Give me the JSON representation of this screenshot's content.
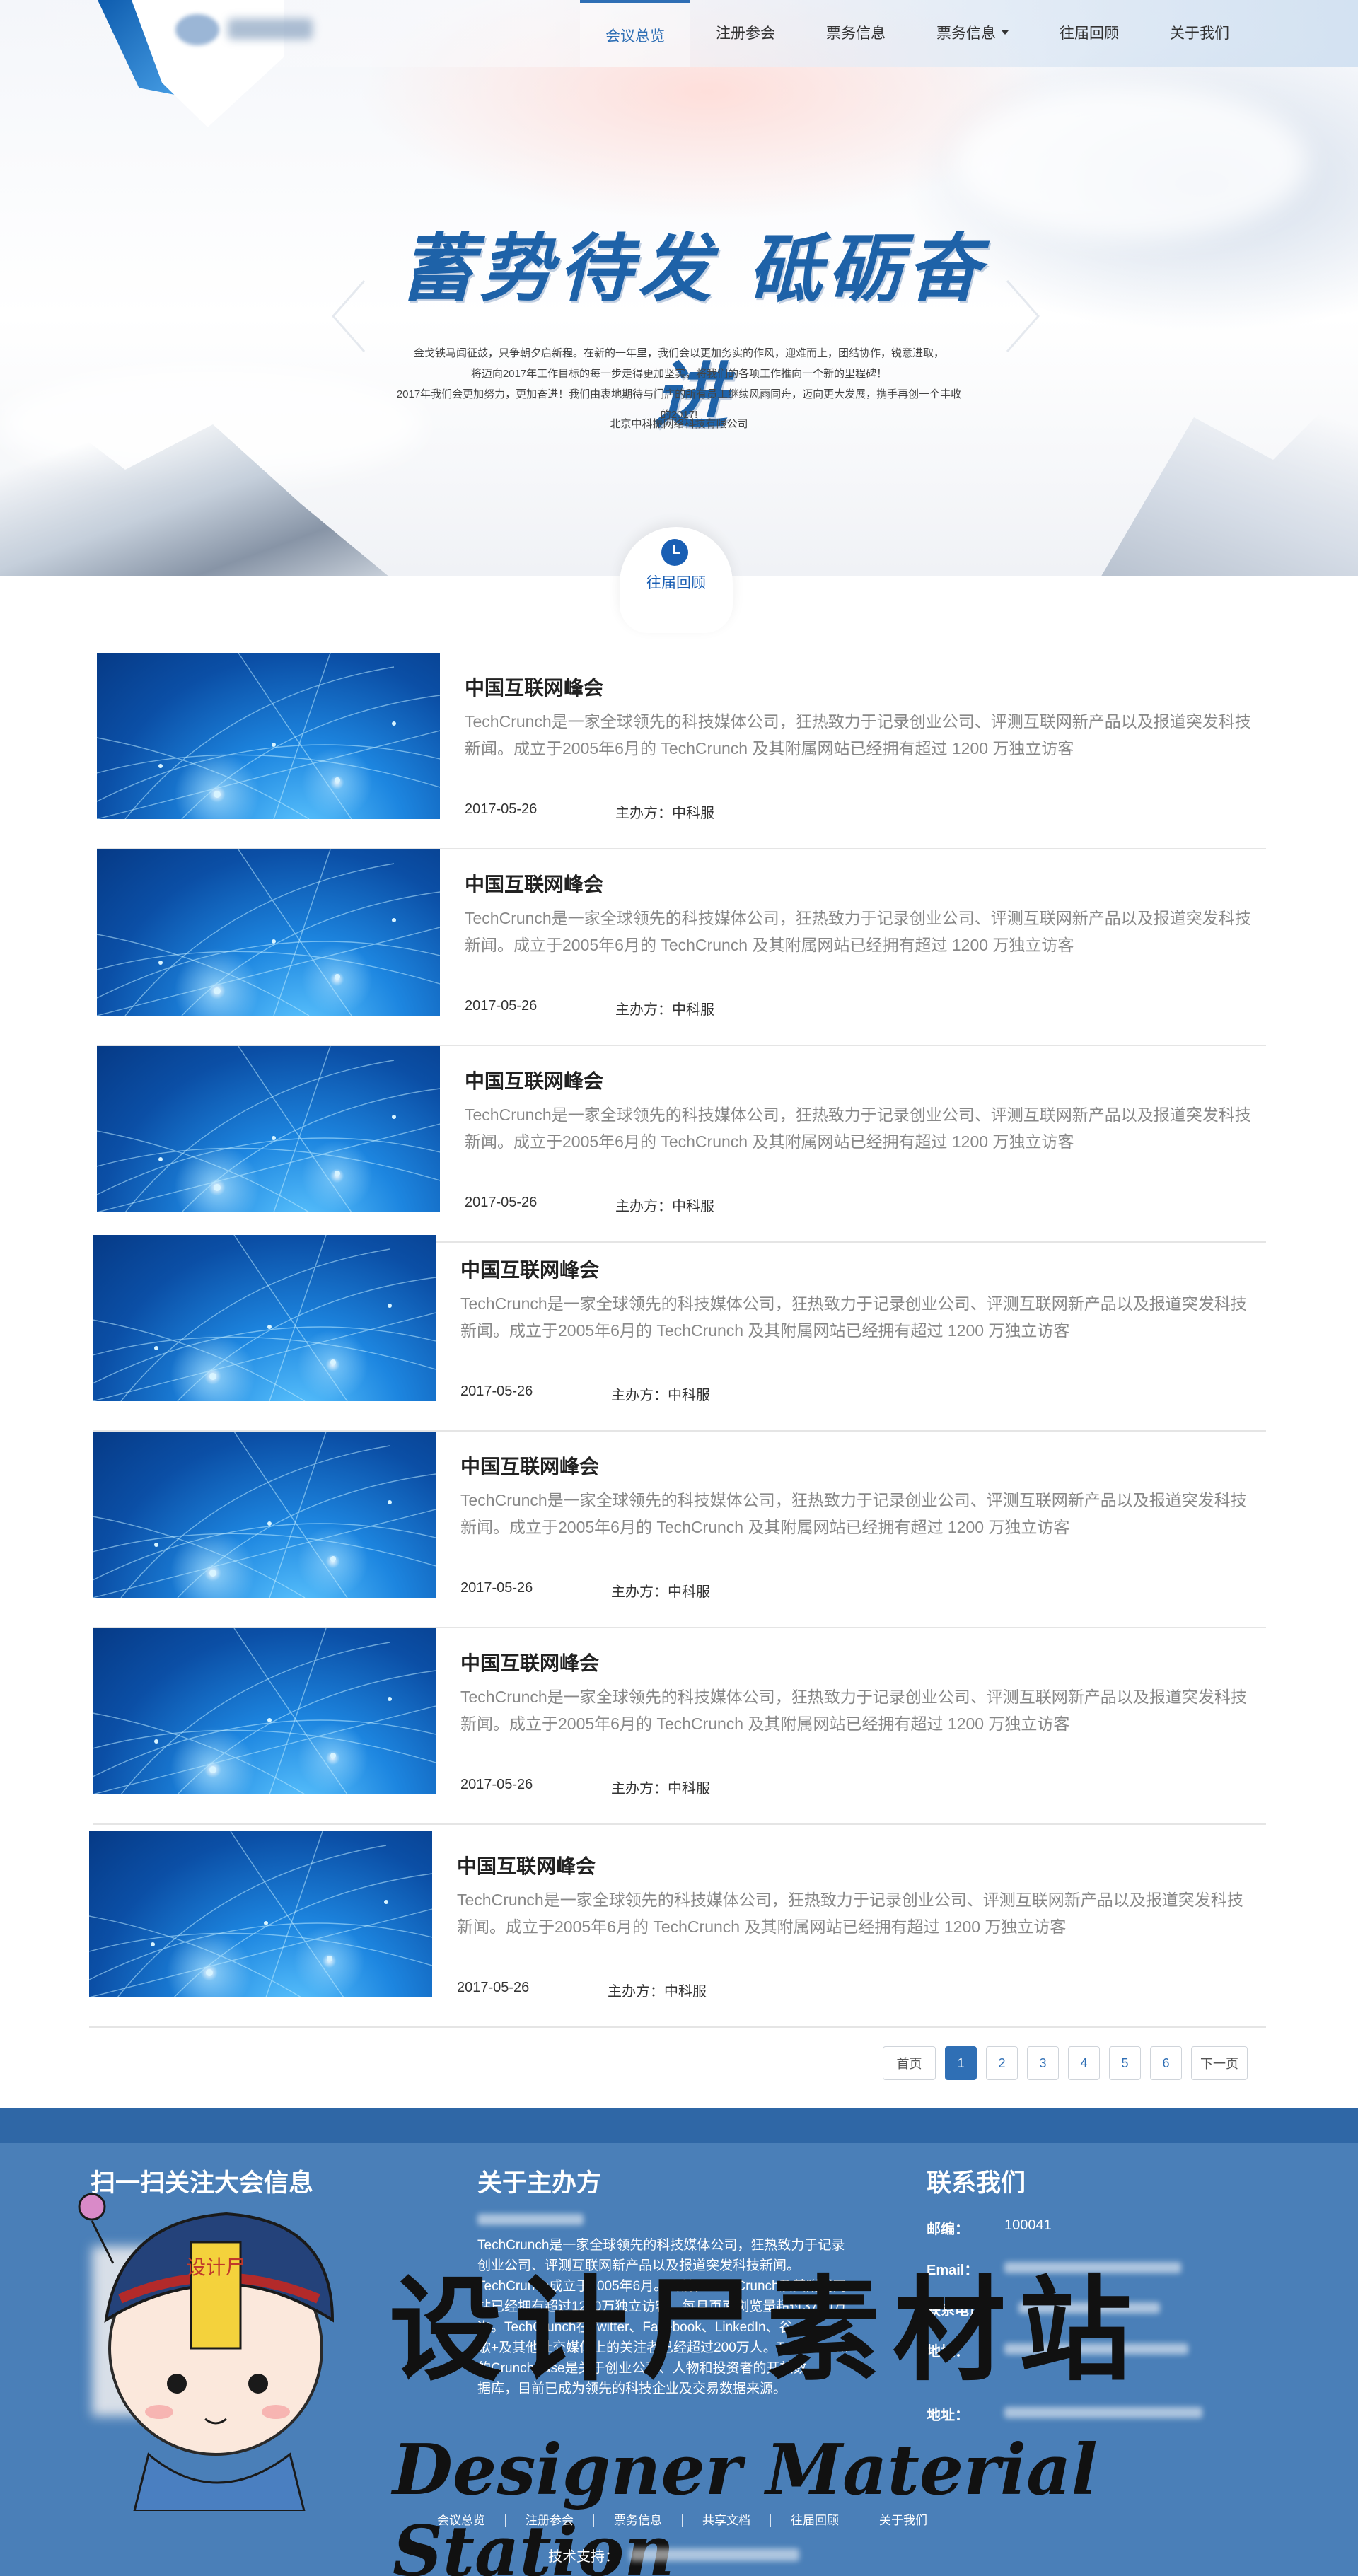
{
  "nav": {
    "items": [
      {
        "label": "会议总览",
        "active": true
      },
      {
        "label": "注册参会"
      },
      {
        "label": "票务信息"
      },
      {
        "label": "票务信息",
        "dropdown": true
      },
      {
        "label": "往届回顾"
      },
      {
        "label": "关于我们"
      }
    ]
  },
  "hero": {
    "slogan": "蓄势待发 砥砺奋进",
    "body_lines": [
      "金戈铁马闻征鼓，只争朝夕启新程。在新的一年里，我们会以更加务实的作风，迎难而上，团结协作，锐意进取，",
      "将迈向2017年工作目标的每一步走得更加坚实，将我们的各项工作推向一个新的里程碑！",
      "2017年我们会更加努力，更加奋进！我们由衷地期待与门店的所有员工继续风雨同舟，迈向更大发展，携手再创一个丰收的2017!"
    ],
    "signature": "北京中科振网络科技有限公司"
  },
  "badge": {
    "label": "往届回顾",
    "icon": "clock-icon"
  },
  "items": [
    {
      "title": "中国互联网峰会",
      "desc": "TechCrunch是一家全球领先的科技媒体公司，狂热致力于记录创业公司、评测互联网新产品以及报道突发科技新闻。成立于2005年6月的 TechCrunch 及其附属网站已经拥有超过 1200 万独立访客",
      "date": "2017-05-26",
      "org": "主办方：中科服"
    },
    {
      "title": "中国互联网峰会",
      "desc": "TechCrunch是一家全球领先的科技媒体公司，狂热致力于记录创业公司、评测互联网新产品以及报道突发科技新闻。成立于2005年6月的 TechCrunch 及其附属网站已经拥有超过 1200 万独立访客",
      "date": "2017-05-26",
      "org": "主办方：中科服"
    },
    {
      "title": "中国互联网峰会",
      "desc": "TechCrunch是一家全球领先的科技媒体公司，狂热致力于记录创业公司、评测互联网新产品以及报道突发科技新闻。成立于2005年6月的 TechCrunch 及其附属网站已经拥有超过 1200 万独立访客",
      "date": "2017-05-26",
      "org": "主办方：中科服"
    },
    {
      "title": "中国互联网峰会",
      "desc": "TechCrunch是一家全球领先的科技媒体公司，狂热致力于记录创业公司、评测互联网新产品以及报道突发科技新闻。成立于2005年6月的 TechCrunch 及其附属网站已经拥有超过 1200 万独立访客",
      "date": "2017-05-26",
      "org": "主办方：中科服"
    },
    {
      "title": "中国互联网峰会",
      "desc": "TechCrunch是一家全球领先的科技媒体公司，狂热致力于记录创业公司、评测互联网新产品以及报道突发科技新闻。成立于2005年6月的 TechCrunch 及其附属网站已经拥有超过 1200 万独立访客",
      "date": "2017-05-26",
      "org": "主办方：中科服"
    },
    {
      "title": "中国互联网峰会",
      "desc": "TechCrunch是一家全球领先的科技媒体公司，狂热致力于记录创业公司、评测互联网新产品以及报道突发科技新闻。成立于2005年6月的 TechCrunch 及其附属网站已经拥有超过 1200 万独立访客",
      "date": "2017-05-26",
      "org": "主办方：中科服"
    },
    {
      "title": "中国互联网峰会",
      "desc": "TechCrunch是一家全球领先的科技媒体公司，狂热致力于记录创业公司、评测互联网新产品以及报道突发科技新闻。成立于2005年6月的 TechCrunch 及其附属网站已经拥有超过 1200 万独立访客",
      "date": "2017-05-26",
      "org": "主办方：中科服"
    }
  ],
  "pagination": {
    "first": "首页",
    "pages": [
      "1",
      "2",
      "3",
      "4",
      "5",
      "6"
    ],
    "current": "1",
    "next": "下一页"
  },
  "footer": {
    "qr_title": "扫一扫关注大会信息",
    "about_title": "关于主办方",
    "about_lines": [
      "TechCrunch是一家全球领先的科技媒体公司，狂热致力于记录",
      "创业公司、评测互联网新产品以及报道突发科技新闻。",
      "TechCrunch成立于2005年6月。目前，TechCrunch及其附属网",
      "站已经拥有超过1200万独立访客，每月页面浏览量超过3700万",
      "次。TechCrunch在Twitter、Facebook、LinkedIn、谷",
      "歌+及其他社交媒体上的关注者已经超过200万人。TechCrunch",
      "的CrunchBase是关于创业公司、人物和投资者的开放数",
      "据库，目前已成为领先的科技企业及交易数据来源。"
    ],
    "contact_title": "联系我们",
    "postcode_label": "邮编：",
    "postcode": "100041",
    "email_label": "Email：",
    "phone_label": "联系电话：",
    "address_label": "地址：",
    "address2_label": "地址：",
    "links": [
      "会议总览",
      "注册参会",
      "票务信息",
      "共享文档",
      "往届回顾",
      "关于我们"
    ],
    "tech_label": "技术支持："
  },
  "watermark": {
    "cn": "设计尸素材站",
    "en": "Designer Material Station",
    "badge": "设计尸"
  },
  "colors": {
    "primary": "#2f6fb5",
    "footer": "#4a7fb8",
    "footer_top": "#2f67a6"
  }
}
